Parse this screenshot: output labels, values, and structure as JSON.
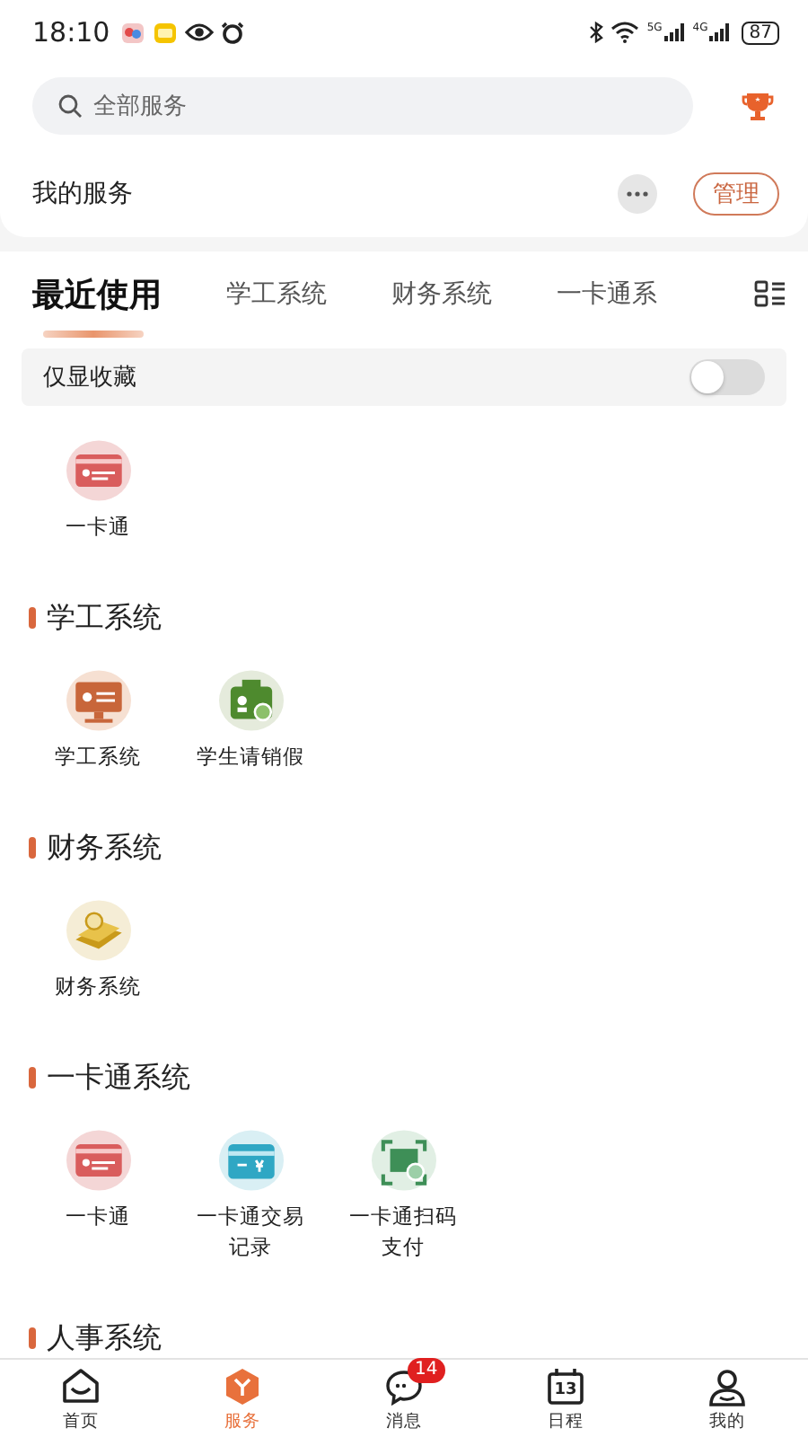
{
  "status_bar": {
    "time": "18:10",
    "network_1": "5G",
    "network_2": "4G",
    "battery": "87"
  },
  "search": {
    "placeholder": "全部服务"
  },
  "my_services": {
    "title": "我的服务",
    "manage_button": "管理"
  },
  "tabs": [
    {
      "label": "最近使用",
      "selected": true
    },
    {
      "label": "学工系统",
      "selected": false
    },
    {
      "label": "财务系统",
      "selected": false
    },
    {
      "label": "一卡通系",
      "selected": false
    }
  ],
  "favorites_toggle": {
    "label": "仅显收藏",
    "on": false
  },
  "recent": [
    {
      "kind": "card",
      "label": "一卡通"
    }
  ],
  "sections": [
    {
      "title": "学工系统",
      "items": [
        {
          "kind": "screen",
          "label": "学工系统"
        },
        {
          "kind": "leave",
          "label": "学生请销假"
        }
      ]
    },
    {
      "title": "财务系统",
      "items": [
        {
          "kind": "money",
          "label": "财务系统"
        }
      ]
    },
    {
      "title": "一卡通系统",
      "items": [
        {
          "kind": "card",
          "label": "一卡通"
        },
        {
          "kind": "payment",
          "label": "一卡通交易记录"
        },
        {
          "kind": "scan",
          "label": "一卡通扫码支付"
        }
      ]
    },
    {
      "title": "人事系统"
    }
  ],
  "bottom_nav": [
    {
      "kind": "home",
      "label": "首页",
      "selected": false
    },
    {
      "kind": "box",
      "label": "服务",
      "selected": true
    },
    {
      "kind": "chat",
      "label": "消息",
      "selected": false,
      "badge": "14"
    },
    {
      "kind": "calendar",
      "label": "日程",
      "selected": false,
      "icon_text": "13"
    },
    {
      "kind": "person",
      "label": "我的",
      "selected": false
    }
  ]
}
